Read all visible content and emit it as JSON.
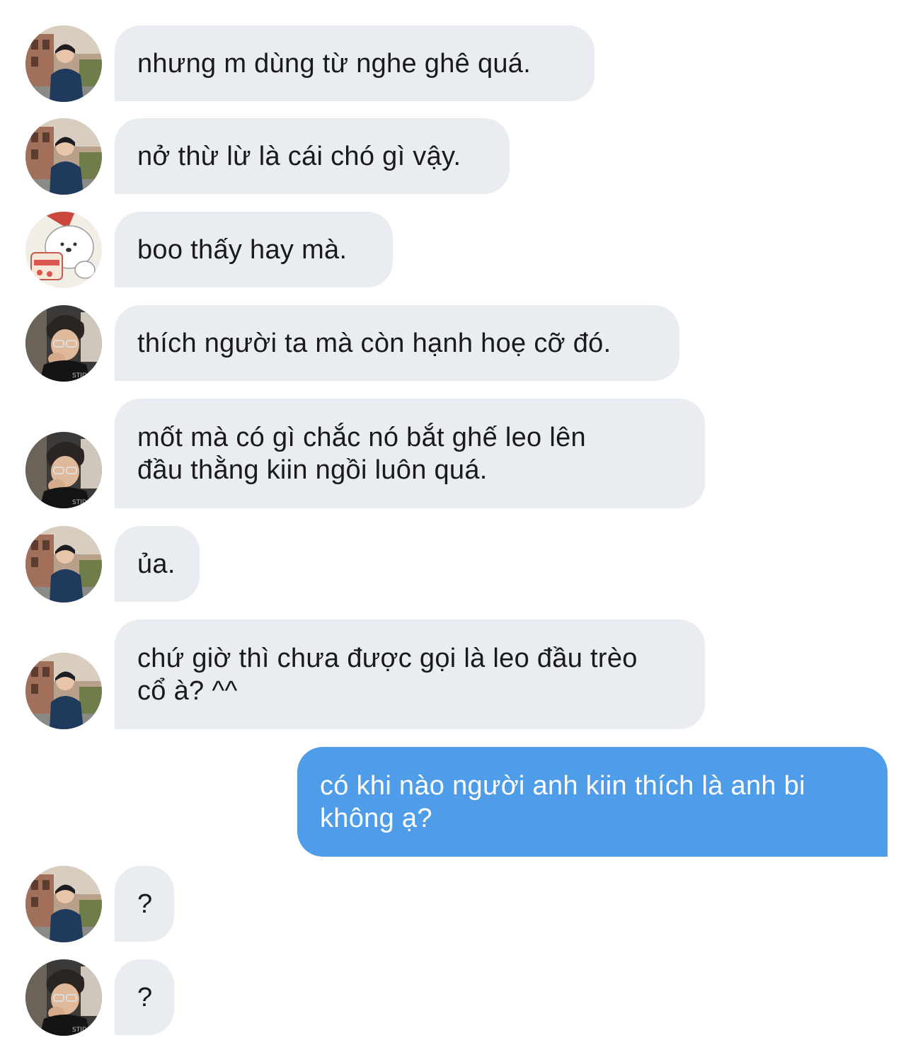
{
  "messages": [
    {
      "sender": "A",
      "text": "nhưng m dùng từ nghe ghê quá."
    },
    {
      "sender": "A",
      "text": "nở thừ lừ là cái chó gì vậy."
    },
    {
      "sender": "B",
      "text": "boo thấy hay mà."
    },
    {
      "sender": "C",
      "text": "thích người ta mà còn hạnh hoẹ cỡ đó."
    },
    {
      "sender": "C",
      "text": "mốt mà có gì chắc nó bắt ghế leo lên\nđầu thằng kiin ngồi luôn quá."
    },
    {
      "sender": "A",
      "text": "ủa."
    },
    {
      "sender": "A",
      "text": "chứ giờ thì chưa được gọi là leo đầu trèo\ncổ à? ^^"
    },
    {
      "sender": "me",
      "text": "có khi nào người anh kiin thích là anh bi\nkhông ạ?"
    },
    {
      "sender": "A",
      "text": "?"
    },
    {
      "sender": "C",
      "text": "?"
    }
  ],
  "colors": {
    "incoming_bubble": "#e9ecf0",
    "outgoing_bubble": "#4f9de8",
    "incoming_text": "#1a1a1a",
    "outgoing_text": "#ffffff"
  }
}
